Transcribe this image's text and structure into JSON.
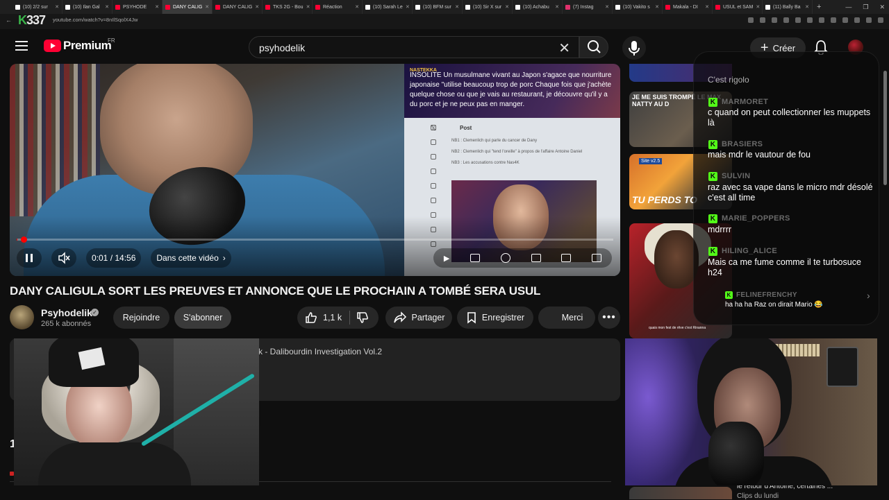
{
  "browser": {
    "tabs": [
      {
        "label": "(10) 2/2 sur",
        "fav": "#ffffff"
      },
      {
        "label": "(10) Ilan Gal",
        "fav": "#ffffff"
      },
      {
        "label": "PSYHODE",
        "fav": "#ff0033"
      },
      {
        "label": "DANY CALIG",
        "fav": "#ff0033",
        "active": true
      },
      {
        "label": "DANY CALIG",
        "fav": "#ff0033"
      },
      {
        "label": "TKS 2G - Bou",
        "fav": "#ff0033"
      },
      {
        "label": "Réaction",
        "fav": "#ff0033"
      },
      {
        "label": "(10) Sarah Le",
        "fav": "#ffffff"
      },
      {
        "label": "(10) BFM sur",
        "fav": "#ffffff"
      },
      {
        "label": "(10) Sir X sur",
        "fav": "#ffffff"
      },
      {
        "label": "(10) Achabu",
        "fav": "#ffffff"
      },
      {
        "label": "(7) Instag",
        "fav": "#e1306c"
      },
      {
        "label": "(10) Vakito s",
        "fav": "#ffffff"
      },
      {
        "label": "Makala - DI",
        "fav": "#ff0033"
      },
      {
        "label": "USUL et SAM",
        "fav": "#ff0033"
      },
      {
        "label": "(11) Bally Ba",
        "fav": "#ffffff"
      }
    ],
    "new_tab": "+",
    "url": "youtube.com/watch?v=8nIlSqolX4Jw",
    "watermark": "337"
  },
  "header": {
    "logo_text": "Premium",
    "country": "FR",
    "search_value": "psyhodelik",
    "create_label": "Créer"
  },
  "player": {
    "time": "0:01 / 14:56",
    "chapter": "Dans cette vidéo",
    "progress_fraction": 0.001,
    "news_tag": "NASTEKKA",
    "news_text": "INSOLITE Un musulmane vivant au Japon s'agace que nourriture japonaise \"utilise beaucoup trop de porc Chaque fois que j'achète quelque chose ou que je vais au restaurant, je découvre qu'il y a du porc et je ne peux pas en manger.",
    "tweet_post": "Post",
    "tweet_lines": [
      "NB1 : Clemenlich qui parle du cancer de Dany",
      "NB2 : Clemenlich qui \"tend l'oreille\" à propos de l'affaire Antoine Daniel",
      "NB3 : Les accusations contre Nas4K"
    ]
  },
  "video": {
    "title": "DANY CALIGULA SORT LES PREUVES ET ANNONCE QUE LE PROCHAIN A TOMBÉ SERA USUL",
    "channel": "Psyhodelik",
    "subscribers": "265 k abonnés",
    "join": "Rejoindre",
    "subscribe": "S'abonner",
    "likes": "1,1 k",
    "share": "Partager",
    "save": "Enregistrer",
    "thanks": "Merci",
    "description_snippet": "k - Dalibourdin Investigation Vol.2",
    "comments_count": "1"
  },
  "sidebar": {
    "rec2_text": "JE ME SUIS TROMPÉ LE MAX NATTY AU D",
    "rec3_badge": "Site v2.5",
    "rec3_text": "TU PERDS TO",
    "rec4_caption": "quais mon fest de rêve c'est Rinanna",
    "bottom_title": "le retour d'Antoine, certaines ...",
    "bottom_sub": "Clips du lundi"
  },
  "chat": {
    "first_msg": "C'est rigolo",
    "messages": [
      {
        "user": "MARMORET",
        "text": "c quand on peut collectionner les muppets là"
      },
      {
        "user": "BRASIERS",
        "text": "mais mdr le vautour de fou"
      },
      {
        "user": "SULVIN",
        "text": "raz avec sa vape dans le micro mdr désolé c'est all time"
      },
      {
        "user": "MARIE_POPPERS",
        "text": "mdrrrr"
      },
      {
        "user": "HILING_ALICE",
        "text": "Mais ca me fume comme il te turbosuce h24"
      }
    ],
    "last_user": "FELINEFRENCHY",
    "last_msg": "ha ha ha Raz on dirait Mario 😂",
    "badge_letter": "K"
  },
  "colors": {
    "youtube_red": "#ff0033",
    "kick_green": "#53fc18",
    "bg": "#0f0f0f"
  }
}
